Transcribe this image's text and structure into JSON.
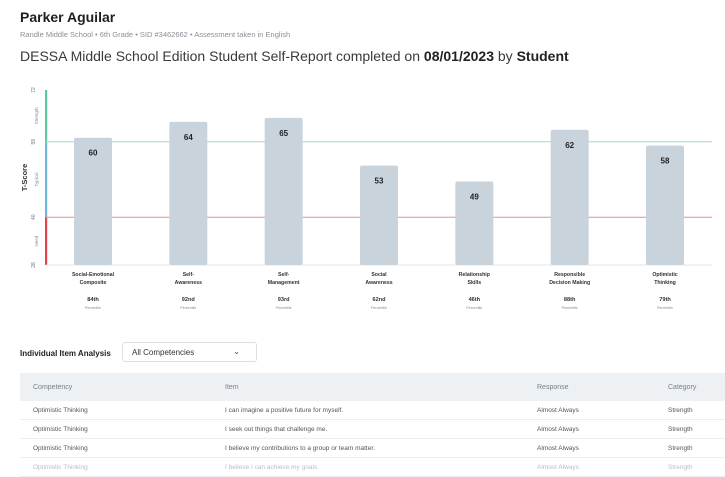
{
  "student": {
    "name": "Parker Aguilar",
    "meta": "Randle Middle School • 6th Grade • SID #3462662 • Assessment taken in English"
  },
  "report": {
    "title_prefix": "DESSA Middle School Edition Student Self-Report completed on ",
    "date": "08/01/2023",
    "by_word": " by ",
    "rater": "Student"
  },
  "chart_data": {
    "type": "bar",
    "ylabel": "T-Score",
    "yticks": [
      28,
      40,
      59,
      72
    ],
    "ylim": [
      28,
      72
    ],
    "bands": [
      {
        "label": "Strength",
        "from": 59,
        "to": 72,
        "color": "#5cc79b"
      },
      {
        "label": "Typical",
        "from": 40,
        "to": 59,
        "color": "#6fb7d9"
      },
      {
        "label": "Need",
        "from": 28,
        "to": 40,
        "color": "#e04848"
      }
    ],
    "thresholds": [
      {
        "value": 59,
        "color": "#a8dcc6"
      },
      {
        "value": 40,
        "color": "#f08a8a"
      }
    ],
    "bar_color": "#c9d3dc",
    "categories": [
      {
        "line1": "Social-Emotional",
        "line2": "Composite",
        "value": 60,
        "pct": "84th"
      },
      {
        "line1": "Self-",
        "line2": "Awareness",
        "value": 64,
        "pct": "92nd"
      },
      {
        "line1": "Self-",
        "line2": "Management",
        "value": 65,
        "pct": "93rd"
      },
      {
        "line1": "Social",
        "line2": "Awareness",
        "value": 53,
        "pct": "62nd"
      },
      {
        "line1": "Relationship",
        "line2": "Skills",
        "value": 49,
        "pct": "46th"
      },
      {
        "line1": "Responsible",
        "line2": "Decision Making",
        "value": 62,
        "pct": "88th"
      },
      {
        "line1": "Optimistic",
        "line2": "Thinking",
        "value": 58,
        "pct": "79th"
      }
    ],
    "percentile_word": "Percentile"
  },
  "item_analysis": {
    "label": "Individual Item Analysis",
    "filter_value": "All Competencies",
    "chevron_icon": "chevron-down-icon",
    "columns": [
      "Competency",
      "Item",
      "Response",
      "Category"
    ],
    "rows": [
      [
        "Optimistic Thinking",
        "I can imagine a positive future for myself.",
        "Almost Always",
        "Strength"
      ],
      [
        "Optimistic Thinking",
        "I seek out things that challenge me.",
        "Almost Always",
        "Strength"
      ],
      [
        "Optimistic Thinking",
        "I believe my contributions to a group or team matter.",
        "Almost Always",
        "Strength"
      ],
      [
        "Optimistic Thinking",
        "I believe I can achieve my goals.",
        "Almost Always",
        "Strength"
      ]
    ]
  }
}
